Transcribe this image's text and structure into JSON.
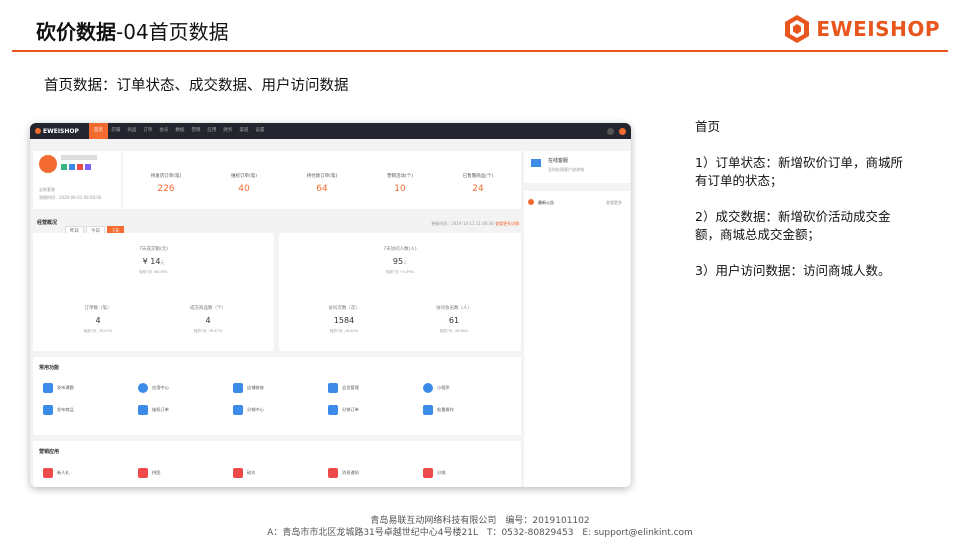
{
  "header": {
    "title_bold": "砍价数据",
    "title_rest": "-04首页数据",
    "logo_text": "EWEISHOP"
  },
  "subtitle": "首页数据：订单状态、成交数据、用户访问数据",
  "shot": {
    "logo": "EWEISHOP",
    "nav": [
      "首页",
      "店铺",
      "商品",
      "订单",
      "会员",
      "数据",
      "营销",
      "应用",
      "财务",
      "渠道",
      "设置"
    ],
    "shop": {
      "version": "全新套餐",
      "expire": "到期时间：2020-06-01 00:00:00"
    },
    "stats": [
      {
        "label": "待发货订单(笔)",
        "value": "226"
      },
      {
        "label": "维权订单(笔)",
        "value": "40"
      },
      {
        "label": "待付款订单(笔)",
        "value": "64"
      },
      {
        "label": "营销活动(个)",
        "value": "10"
      },
      {
        "label": "已售罄商品(个)",
        "value": "24"
      }
    ],
    "service": {
      "title": "在线客服",
      "desc": "及时处理客户咨询和"
    },
    "notice": {
      "label": "最新公告",
      "more": "查看更多"
    },
    "overview": {
      "title": "经营概况",
      "tabs": [
        "昨日",
        "今日",
        "7天"
      ],
      "updated": "更新时间：2019-10-11 11:46:36",
      "more": "查看更多详情",
      "left": {
        "main_label": "7天成交额(元)",
        "main_value": "¥ 14",
        "main_unit": "元",
        "main_cmp": "较前7天 -66.76%",
        "subs": [
          {
            "label": "订单数（笔）",
            "value": "4",
            "cmp": "较前7天 -76.47%"
          },
          {
            "label": "成交商品数（个）",
            "value": "4",
            "cmp": "较前7天 -76.47%"
          }
        ]
      },
      "right": {
        "main_label": "7天访问人数(人)",
        "main_value": "95",
        "main_unit": "人",
        "main_cmp": "较前7天 +4.39%",
        "subs": [
          {
            "label": "访问次数（次）",
            "value": "1584",
            "cmp": "较前7天 -16.65%"
          },
          {
            "label": "访问会员数（人）",
            "value": "61",
            "cmp": "较前7天 -16.66%"
          }
        ]
      }
    },
    "common": {
      "title": "常用功能",
      "items": [
        "发布课题",
        "应用中心",
        "店铺装修",
        "会员管理",
        "小程序",
        "发布商品",
        "维权订单",
        "分销中心",
        "分销订单",
        "批量操作"
      ]
    },
    "marketing": {
      "title": "营销应用",
      "items": [
        "新人礼",
        "拼团",
        "砍价",
        "消息通知",
        "分销"
      ]
    }
  },
  "notes": {
    "title": "首页",
    "item1": "1）订单状态：新增砍价订单，商城所有订单的状态；",
    "item2": "2）成交数据：新增砍价活动成交金额，商城总成交金额；",
    "item3": "3）用户访问数据：访问商城人数。"
  },
  "footer": {
    "line1": "青岛易联互动网络科技有限公司　编号：2019101102",
    "line2": "A：青岛市市北区龙城路31号卓越世纪中心4号楼21L　T：0532-80829453　E: support@elinkint.com"
  },
  "colors": {
    "accent": "#e8561e",
    "topbar": "#23262f"
  }
}
